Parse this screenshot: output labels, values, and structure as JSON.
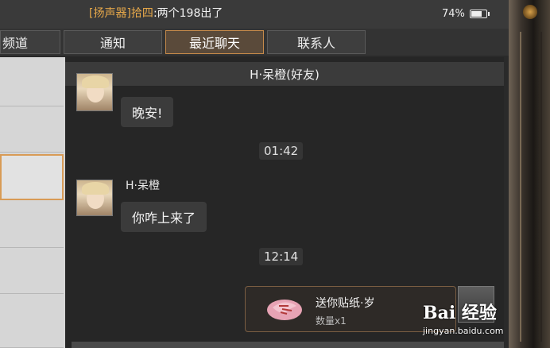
{
  "status": {
    "speaker_tag": "[扬声器]拾四",
    "speaker_text": ":两个198出了",
    "battery": "74%",
    "battery_level": 0.74
  },
  "tabs": [
    {
      "label": "频道"
    },
    {
      "label": "通知"
    },
    {
      "label": "最近聊天"
    },
    {
      "label": "联系人"
    }
  ],
  "chat": {
    "header": "H·呆橙(好友)",
    "messages": [
      {
        "text": "晚安!"
      },
      {
        "time": "01:42"
      },
      {
        "sender": "H·呆橙",
        "text": "你咋上来了"
      },
      {
        "time": "12:14"
      }
    ],
    "gift": {
      "title": "送你贴纸·岁",
      "quantity": "数量x1"
    }
  },
  "watermark": {
    "logo": "Bai 经验",
    "url": "jingyan.baidu.com"
  }
}
